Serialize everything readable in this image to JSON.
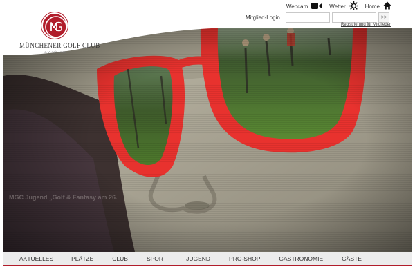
{
  "colors": {
    "brand": "#b11d2b",
    "nav_bg": "#ececec",
    "glasses": "#e8322e"
  },
  "logo": {
    "name": "MÜNCHENER GOLF CLUB",
    "subline": "e.V. seit 1910",
    "icon": "mgc-logo-icon"
  },
  "toplinks": [
    {
      "label": "Webcam",
      "icon": "video-camera-icon"
    },
    {
      "label": "Wetter",
      "icon": "sun-icon"
    },
    {
      "label": "Home",
      "icon": "home-icon"
    }
  ],
  "login": {
    "label": "Mitglied-Login",
    "user_value": "",
    "pass_value": "",
    "submit_label": ">>",
    "register_link": "Registrierung für Mitglieder"
  },
  "hero": {
    "caption": "MGC Jugend „Golf & Fantasy am 26."
  },
  "nav": {
    "items": [
      "AKTUELLES",
      "PLÄTZE",
      "CLUB",
      "SPORT",
      "JUGEND",
      "PRO-SHOP",
      "GASTRONOMIE",
      "GÄSTE"
    ]
  }
}
